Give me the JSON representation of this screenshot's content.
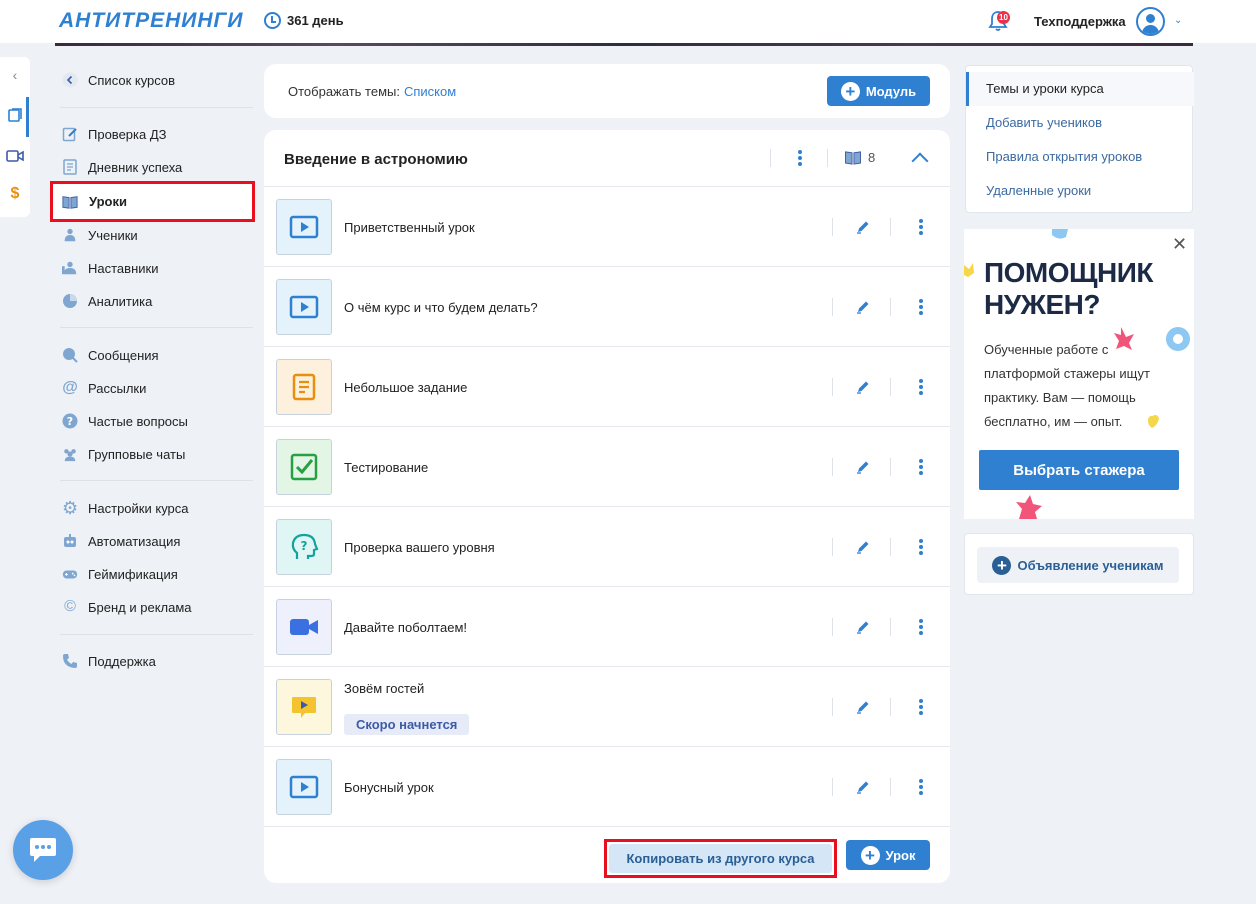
{
  "header": {
    "logo": "АНТИТРЕНИНГИ",
    "days": "361 день",
    "notifications": "10",
    "user_name": "Техподдержка"
  },
  "nav": {
    "back_label": "Список курсов",
    "items": [
      {
        "label": "Проверка ДЗ",
        "icon": "edit-icon"
      },
      {
        "label": "Дневник успеха",
        "icon": "document-icon"
      },
      {
        "label": "Уроки",
        "icon": "book-icon",
        "active": true
      },
      {
        "label": "Ученики",
        "icon": "students-icon"
      },
      {
        "label": "Наставники",
        "icon": "mentors-icon"
      },
      {
        "label": "Аналитика",
        "icon": "pie-chart-icon"
      },
      {
        "label": "Сообщения",
        "icon": "messages-icon"
      },
      {
        "label": "Рассылки",
        "icon": "at-icon"
      },
      {
        "label": "Частые вопросы",
        "icon": "question-icon"
      },
      {
        "label": "Групповые чаты",
        "icon": "group-icon"
      },
      {
        "label": "Настройки курса",
        "icon": "gear-icon"
      },
      {
        "label": "Автоматизация",
        "icon": "robot-icon"
      },
      {
        "label": "Геймификация",
        "icon": "gamepad-icon"
      },
      {
        "label": "Бренд и реклама",
        "icon": "copyright-icon"
      },
      {
        "label": "Поддержка",
        "icon": "phone-icon"
      }
    ]
  },
  "display": {
    "label": "Отображать темы:",
    "value": "Списком",
    "module_button": "Модуль"
  },
  "module": {
    "title": "Введение в астрономию",
    "lesson_count": "8",
    "lessons": [
      {
        "title": "Приветственный урок",
        "type": "video"
      },
      {
        "title": "О чём курс и что будем делать?",
        "type": "video"
      },
      {
        "title": "Небольшое задание",
        "type": "task"
      },
      {
        "title": "Тестирование",
        "type": "test"
      },
      {
        "title": "Проверка вашего уровня",
        "type": "survey"
      },
      {
        "title": "Давайте поболтаем!",
        "type": "meeting"
      },
      {
        "title": "Зовём гостей",
        "type": "webinar",
        "badge": "Скоро начнется"
      },
      {
        "title": "Бонусный урок",
        "type": "video"
      }
    ],
    "copy_button": "Копировать из другого курса",
    "lesson_button": "Урок"
  },
  "right_menu": {
    "items": [
      "Темы и уроки курса",
      "Добавить учеников",
      "Правила открытия уроков",
      "Удаленные уроки"
    ]
  },
  "promo": {
    "title_line1": "ПОМОЩНИК",
    "title_line2": "НУЖЕН?",
    "text": "Обученные работе с платформой стажеры ищут практику. Вам — помощь бесплатно, им — опыт.",
    "button": "Выбрать стажера"
  },
  "announcement": {
    "button": "Объявление ученикам"
  },
  "colors": {
    "accent": "#2f80d1",
    "highlight": "#e8101e"
  }
}
